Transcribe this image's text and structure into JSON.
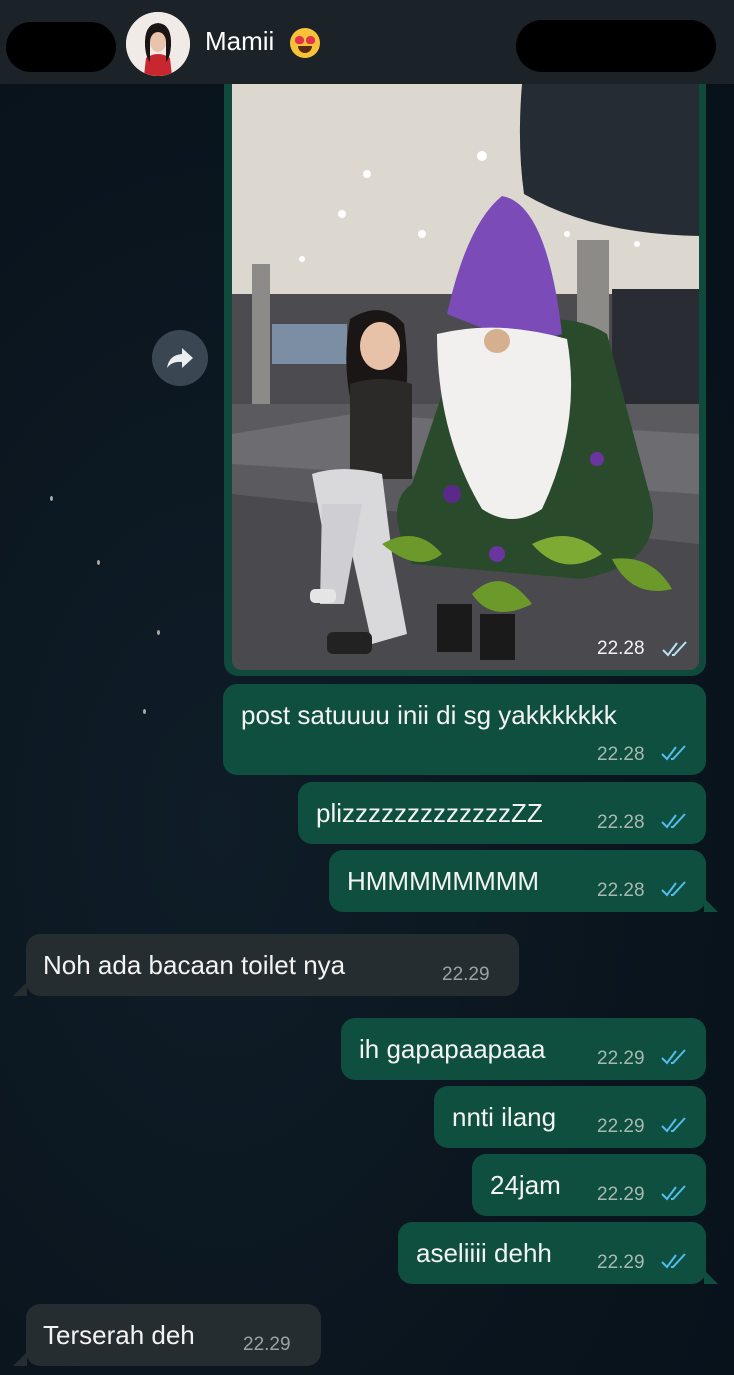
{
  "header": {
    "contact_name": "Mamii",
    "contact_emoji": "heart-eyes-cat-emoji"
  },
  "photo_message": {
    "time": "22.28",
    "status": "read"
  },
  "messages": [
    {
      "text": "post satuuuu inii di sg yakkkkkkk",
      "time": "22.28",
      "direction": "out"
    },
    {
      "text": "plizzzzzzzzzzzzzZZ",
      "time": "22.28",
      "direction": "out"
    },
    {
      "text": "HMMMMMMMM",
      "time": "22.28",
      "direction": "out"
    },
    {
      "text": "Noh ada bacaan toilet nya",
      "time": "22.29",
      "direction": "in"
    },
    {
      "text": "ih gapapaapaaa",
      "time": "22.29",
      "direction": "out"
    },
    {
      "text": "nnti ilang",
      "time": "22.29",
      "direction": "out"
    },
    {
      "text": "24jam",
      "time": "22.29",
      "direction": "out"
    },
    {
      "text": "aseliiii dehh",
      "time": "22.29",
      "direction": "out"
    },
    {
      "text": "Terserah deh",
      "time": "22.29",
      "direction": "in"
    }
  ],
  "colors": {
    "outgoing_bubble": "#0f4f40",
    "incoming_bubble": "#262d31",
    "read_ticks": "#53bdeb"
  }
}
